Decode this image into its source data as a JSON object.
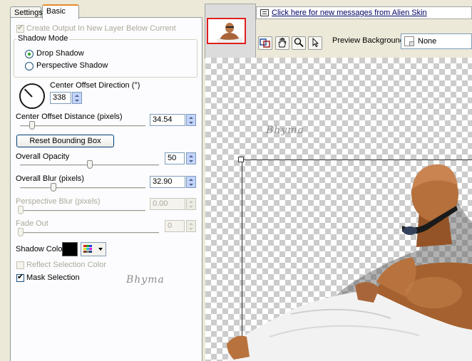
{
  "tabs": [
    {
      "label": "Settings"
    },
    {
      "label": "Basic"
    }
  ],
  "basic": {
    "create_output_label": "Create Output In New Layer Below Current",
    "create_output_checked": true,
    "shadow_mode": {
      "legend": "Shadow Mode",
      "options": [
        "Drop Shadow",
        "Perspective Shadow"
      ],
      "selected": "Drop Shadow"
    },
    "center_offset_direction": {
      "label": "Center Offset Direction (°)",
      "value": "338",
      "angle_degrees": 338
    },
    "center_offset_distance": {
      "label": "Center Offset Distance (pixels)",
      "value": "34.54",
      "slider_fraction": 0.09
    },
    "reset_button": "Reset Bounding Box",
    "overall_opacity": {
      "label": "Overall Opacity",
      "value": "50",
      "slider_fraction": 0.5
    },
    "overall_blur": {
      "label": "Overall Blur (pixels)",
      "value": "32.90",
      "slider_fraction": 0.24
    },
    "perspective_blur": {
      "label": "Perspective Blur (pixels)",
      "value": "0.00",
      "slider_fraction": 0.0,
      "disabled": true
    },
    "fade_out": {
      "label": "Fade Out",
      "value": "0",
      "slider_fraction": 0.0,
      "disabled": true
    },
    "shadow_color": {
      "label": "Shadow Color",
      "color": "#000000"
    },
    "reflect_selection_color": {
      "label": "Reflect Selection Color",
      "checked": false,
      "disabled": true
    },
    "mask_selection": {
      "label": "Mask Selection",
      "checked": true
    },
    "watermark": "Bhyma"
  },
  "preview": {
    "message_link": "Click here for new messages from Alien Skin",
    "toolbar_icons": [
      "preview-toggle-icon",
      "hand-icon",
      "zoom-icon",
      "pointer-icon"
    ],
    "background_label": "Preview Background:",
    "background_value": "None",
    "watermark": "Bhyma"
  }
}
